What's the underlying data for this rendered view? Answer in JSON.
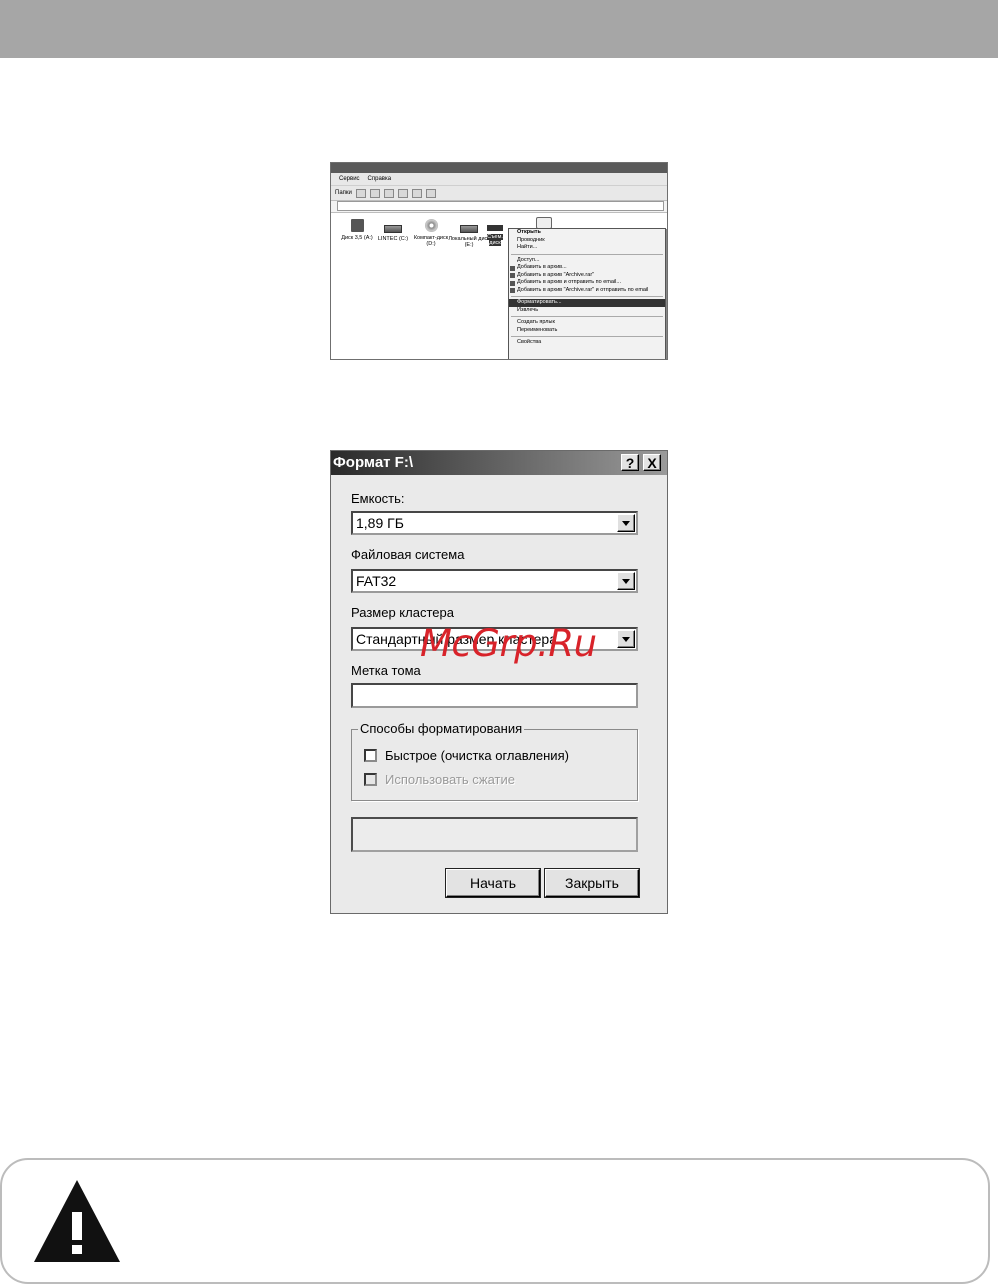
{
  "explorer": {
    "menu": [
      "Сервис",
      "Справка"
    ],
    "toolbar_back": "Папки",
    "drives": [
      {
        "label": "Диск 3,5 (A:)",
        "icon": "floppy-drive-icon"
      },
      {
        "label": "LINTEC (C:)",
        "icon": "hard-drive-icon"
      },
      {
        "label": "Компакт-диск (D:)",
        "icon": "cd-drive-icon"
      },
      {
        "label": "Локальный диск (E:)",
        "icon": "hard-drive-icon"
      },
      {
        "label": "Съем. диск",
        "icon": "removable-drive-icon"
      }
    ],
    "context_menu": {
      "open": "Открыть",
      "explorer": "Проводник",
      "find": "Найти...",
      "access": "Доступ...",
      "add_archive": "Добавить в архив...",
      "add_archive_named": "Добавить в архив \"Archive.rar\"",
      "add_archive_email": "Добавить в архив и отправить по email...",
      "add_archive_named_email": "Добавить в архив \"Archive.rar\" и отправить по email",
      "format": "Форматировать...",
      "eject": "Извлечь",
      "create_shortcut": "Создать ярлык",
      "rename": "Переименовать",
      "properties": "Свойства"
    }
  },
  "dialog": {
    "title": "Формат F:\\",
    "help_btn": "?",
    "close_btn": "X",
    "capacity_label": "Емкость:",
    "capacity_value": "1,89 ГБ",
    "fs_label": "Файловая система",
    "fs_value": "FAT32",
    "cluster_label": "Размер кластера",
    "cluster_value": "Стандартный размер кластера",
    "volume_label": "Метка тома",
    "volume_value": "",
    "options_legend": "Способы форматирования",
    "quick_format": "Быстрое (очистка оглавления)",
    "compression": "Использовать сжатие",
    "start_btn": "Начать",
    "close_button": "Закрыть"
  },
  "watermark": "McGrp.Ru",
  "colors": {
    "watermark": "#d8232a",
    "top_band": "#a6a6a6"
  }
}
